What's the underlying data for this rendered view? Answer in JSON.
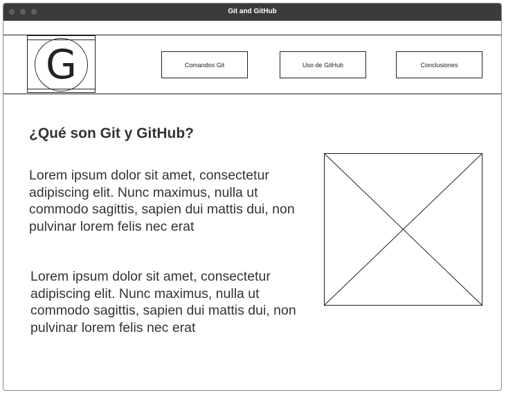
{
  "window": {
    "title": "Git and GitHub"
  },
  "logo": {
    "letter": "G"
  },
  "nav": {
    "items": [
      {
        "label": "Comandos Git"
      },
      {
        "label": "Uso de GitHub"
      },
      {
        "label": "Conclusiones"
      }
    ]
  },
  "main": {
    "heading": "¿Qué son Git y GitHub?",
    "paragraphs": [
      "Lorem ipsum dolor sit amet, consectetur adipiscing elit. Nunc maximus, nulla ut commodo sagittis, sapien dui mattis dui, non pulvinar lorem felis nec erat",
      "Lorem ipsum dolor sit amet, consectetur adipiscing elit. Nunc maximus, nulla ut commodo sagittis, sapien dui mattis dui, non pulvinar lorem felis nec erat"
    ]
  },
  "colors": {
    "titlebar": "#3b3b3b",
    "line": "#1e1e1e",
    "text": "#333333"
  }
}
